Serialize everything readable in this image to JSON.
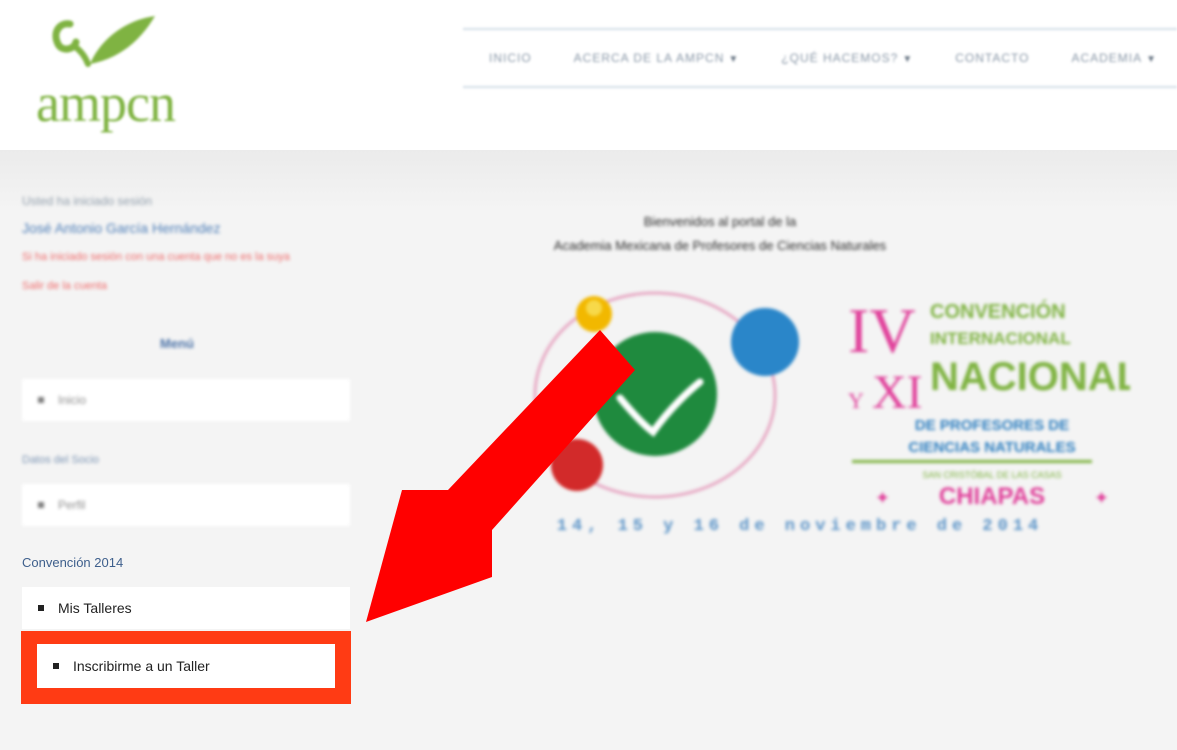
{
  "header": {
    "logo_text": "ampcn",
    "nav": [
      {
        "label": "INICIO",
        "caret": false
      },
      {
        "label": "ACERCA DE LA AMPCN",
        "caret": true
      },
      {
        "label": "¿QUÉ HACEMOS?",
        "caret": true
      },
      {
        "label": "CONTACTO",
        "caret": false
      },
      {
        "label": "ACADEMIA",
        "caret": true
      }
    ]
  },
  "sidebar": {
    "welcome_small": "Usted ha iniciado sesión",
    "user_name": "José Antonio García Hernández",
    "link_1": "Si ha iniciado sesión con una cuenta que no es la suya",
    "link_2": "Salir de la cuenta",
    "menu_title": "Menú",
    "menu_item_1": "Inicio",
    "section_1_title": "Datos del Socio",
    "menu_item_2": "Perfil",
    "section_2_title": "Convención 2014",
    "talleres_label": "Mis Talleres",
    "inscribirme_label": "Inscribirme a un Taller"
  },
  "main": {
    "welcome_line_1": "Bienvenidos al portal de la",
    "welcome_line_2": "Academia Mexicana de Profesores de Ciencias Naturales",
    "banner": {
      "roman_1": "IV",
      "roman_2": "XI",
      "y": "Y",
      "convencion": "CONVENCIÓN",
      "internacional": "INTERNACIONAL",
      "nacional": "NACIONAL",
      "de_profesores": "DE PROFESORES DE",
      "ciencias": "CIENCIAS NATURALES",
      "sede": "SAN CRISTÓBAL DE LAS CASAS",
      "chiapas": "CHIAPAS",
      "dates": "14, 15 y 16 de noviembre de 2014"
    }
  },
  "colors": {
    "highlight_border": "#ff3b14",
    "arrow": "#ff0000",
    "logo_green": "#7fb342",
    "link_blue": "#3e5f8c"
  }
}
